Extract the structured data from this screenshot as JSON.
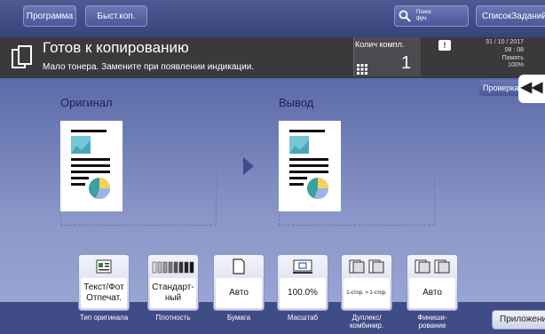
{
  "topbar": {
    "program_label": "Программа",
    "quick_label": "Быст.коп.",
    "search_label_1": "Поиск",
    "search_label_2": "фун.",
    "joblist_label": "СписокЗаданий"
  },
  "status": {
    "title": "Готов к копированию",
    "message": "Мало тонера. Замените при появлении индикации.",
    "sets_label": "Колич компл.",
    "sets_value": "1",
    "warning_symbol": "!",
    "date": "31 / 10 / 2017",
    "time": "08 : 08",
    "memory_label": "Память",
    "memory_value": "100%"
  },
  "main": {
    "original_label": "Оригинал",
    "output_label": "Вывод",
    "check_label": "Проверка",
    "collapse_symbol": "◀◀"
  },
  "functions": [
    {
      "icon": "document-type-icon",
      "value": "Текст/Фот Отпечат.",
      "label": "Тип оригинала"
    },
    {
      "icon": "density-icon",
      "value": "Стандарт-ный",
      "label": "Плотность"
    },
    {
      "icon": "paper-icon",
      "value": "Авто",
      "label": "Бумага"
    },
    {
      "icon": "zoom-icon",
      "value": "100.0%",
      "label": "Масштаб"
    },
    {
      "icon": "duplex-icon",
      "value": "1-стор. > 1-стор.",
      "label": "Дуплекс/ комбинир."
    },
    {
      "icon": "finishing-icon",
      "value": "Авто",
      "label": "Финиши-рование"
    }
  ],
  "application_label": "Приложение",
  "colors": {
    "topbar": "#4e5b93",
    "status_bg": "#3a3a3c",
    "main_top": "#5b6aa8",
    "func_bar": "#3f4c86"
  }
}
